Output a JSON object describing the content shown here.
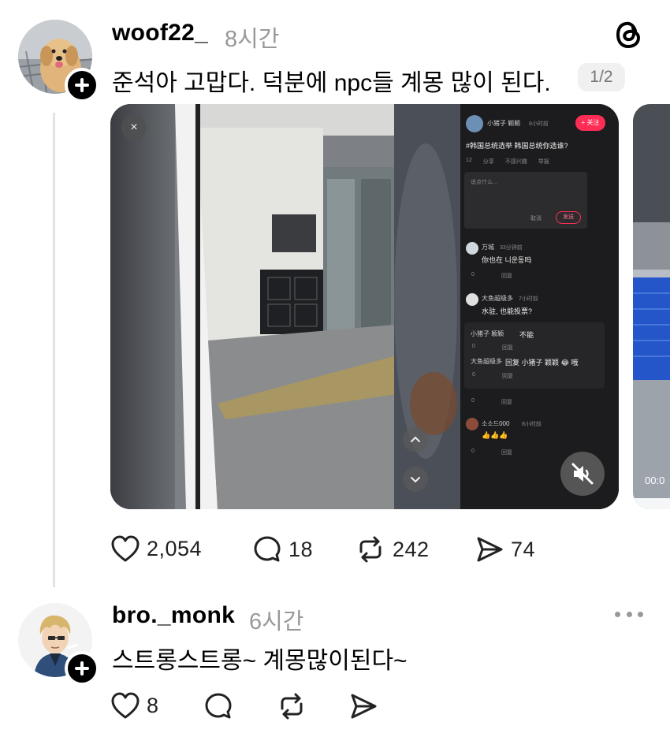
{
  "post1": {
    "username": "woof22_",
    "time": "8시간",
    "text": "준석아 고맙다. 덕분에 npc들 계몽 많이 된다.",
    "pager": "1/2",
    "actions": {
      "likes": "2,054",
      "comments": "18",
      "reposts": "242",
      "shares": "74"
    },
    "video": {
      "close_glyph": "×",
      "panel": {
        "poster_name": "小猪子 颖颖",
        "poster_time": "8小时前",
        "follow_label": "+ 关注",
        "caption": "#韩国总统选举 韩国总统你选谁?",
        "stats": [
          "12",
          "分享",
          "不感兴趣",
          "举报"
        ],
        "comment_placeholder": "说点什么...",
        "cancel_label": "取消",
        "send_label": "发送",
        "comments": [
          {
            "name": "万城",
            "time": "33分钟前",
            "text": "你也在 니운동吗",
            "reply": "回复",
            "likes": "0"
          },
          {
            "name": "大鱼超级多",
            "time": "7小时前",
            "text": "水驻, 也能投票?",
            "reply": "回复",
            "likes": "0"
          },
          {
            "name": "小猪子 颖颖",
            "time": "",
            "text": "不能",
            "reply": "回复",
            "likes": "0"
          },
          {
            "name": "大鱼超级多",
            "time": "",
            "text": "回复 小猪子 颖颖 😂 哦",
            "reply": "回复",
            "likes": "0"
          },
          {
            "name": "소소드000",
            "time": "8小时前",
            "text": "👍👍👍",
            "reply": "回复",
            "likes": "0"
          }
        ]
      }
    },
    "second_media_time": "00:0"
  },
  "post2": {
    "username": "bro._monk",
    "time": "6시간",
    "text": "스트롱스트롱~ 계몽많이된다~",
    "actions": {
      "likes": "8"
    }
  },
  "colors": {
    "accent_red": "#ff2d55",
    "text_muted": "#999999",
    "thread_line": "#e3e3e3"
  }
}
